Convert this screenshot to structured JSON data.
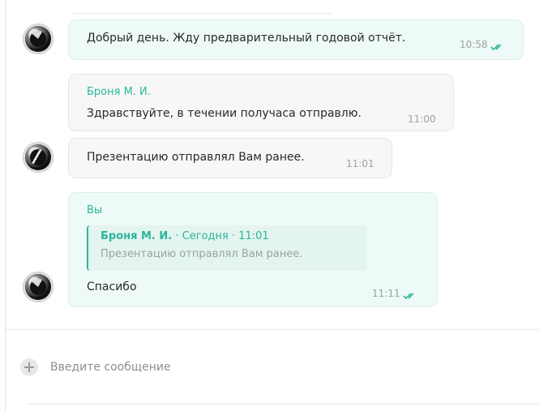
{
  "messages": [
    {
      "id": "m1",
      "direction": "out",
      "text": "Добрый день. Жду предварительный годовой отчёт.",
      "time": "10:58",
      "read": true,
      "avatar_icon": "contact-avatar-icon"
    },
    {
      "id": "m2",
      "direction": "in",
      "sender": "Броня М. И.",
      "text": "Здравствуйте, в течении получаса отправлю.",
      "time": "11:00"
    },
    {
      "id": "m3",
      "direction": "in",
      "text": "Презентацию отправлял Вам ранее.",
      "time": "11:01",
      "avatar_icon": "sender-avatar-icon"
    },
    {
      "id": "m4",
      "direction": "out",
      "sender": "Вы",
      "reply": {
        "author": "Броня М. И.",
        "meta": " · Сегодня · 11:01",
        "text": "Презентацию отправлял Вам ранее."
      },
      "text": "Спасибо",
      "time": "11:11",
      "read": true,
      "avatar_icon": "contact-avatar-icon"
    }
  ],
  "composer": {
    "placeholder": "Введите сообщение",
    "value": "",
    "attach_icon": "plus-icon"
  },
  "colors": {
    "accent": "#2ab59c",
    "outgoing_bubble": "#eefaf7",
    "incoming_bubble": "#f7f7f7",
    "time_text": "#9aa3a0"
  }
}
